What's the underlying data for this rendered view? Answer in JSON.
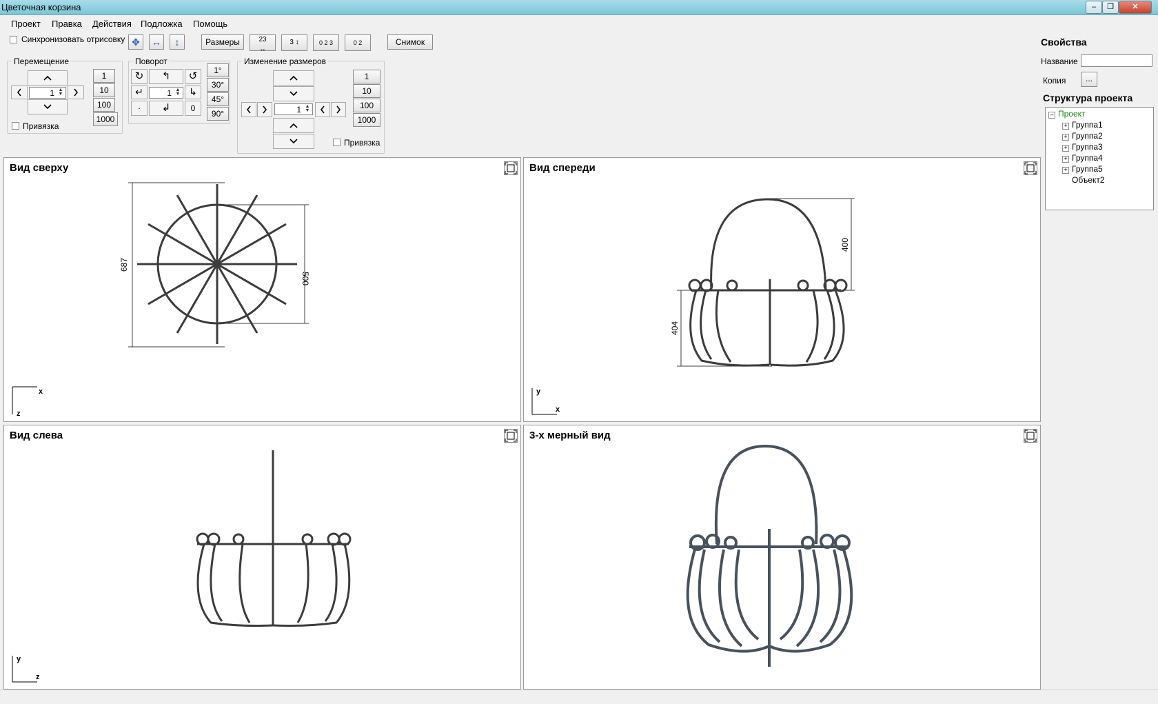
{
  "window": {
    "title": "Цветочная корзина"
  },
  "menu": [
    "Проект",
    "Правка",
    "Действия",
    "Подложка",
    "Помощь"
  ],
  "toolbar": {
    "sync_label": "Синхронизовать отрисовку",
    "sizes_label": "Размеры",
    "dim_a_label": "23",
    "dim_b_label": "3",
    "dim_c_label": "0 2 3",
    "dim_d_label": "0 2",
    "snapshot_label": "Снимок"
  },
  "move_group": {
    "title": "Перемещение",
    "value": "1",
    "steps": [
      "1",
      "10",
      "100",
      "1000"
    ],
    "snap_label": "Привязка"
  },
  "rotate_group": {
    "title": "Поворот",
    "value": "1",
    "angles": [
      "1°",
      "30°",
      "45°",
      "90°"
    ],
    "dot_label": ".",
    "zero_label": "0"
  },
  "resize_group": {
    "title": "Изменение размеров",
    "value": "1",
    "steps": [
      "1",
      "10",
      "100",
      "1000"
    ],
    "snap_label": "Привязка"
  },
  "views": {
    "top": {
      "title": "Вид сверху",
      "dim_outer": "687",
      "dim_inner": "500",
      "axis_h": "x",
      "axis_v": "z"
    },
    "front": {
      "title": "Вид спереди",
      "dim_handle": "400",
      "dim_body": "404",
      "axis_h": "x",
      "axis_v": "y"
    },
    "left": {
      "title": "Вид слева",
      "axis_h": "z",
      "axis_v": "y"
    },
    "threed": {
      "title": "3-х мерный вид"
    }
  },
  "properties": {
    "title": "Свойства",
    "name_label": "Название",
    "name_value": "",
    "copy_label": "Копия",
    "copy_button": "...",
    "structure_title": "Структура проекта"
  },
  "tree": {
    "root": "Проект",
    "groups": [
      "Группа1",
      "Группа2",
      "Группа3",
      "Группа4",
      "Группа5"
    ],
    "object": "Объект2",
    "root_color": "#1a8a1a"
  }
}
